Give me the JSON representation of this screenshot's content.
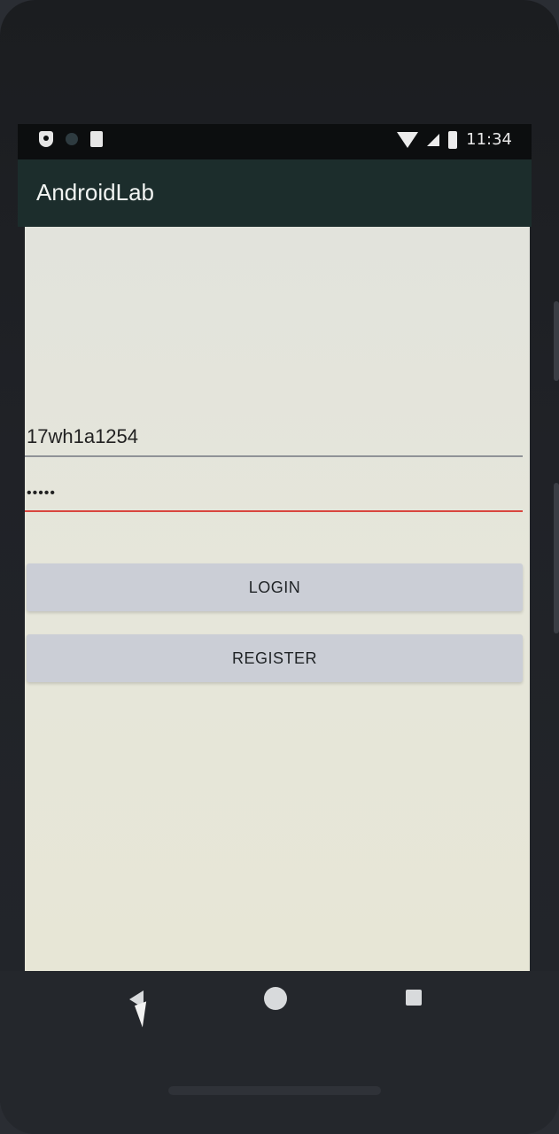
{
  "status_bar": {
    "time": "11:34",
    "left_icons": [
      "shield-icon",
      "dot-icon",
      "sd-card-icon"
    ],
    "right_icons": [
      "wifi-icon",
      "signal-icon",
      "battery-icon"
    ]
  },
  "app_bar": {
    "title": "AndroidLab"
  },
  "form": {
    "username_value": "17wh1a1254",
    "password_value": "•••••",
    "username_underline_color": "#8f9297",
    "password_underline_color": "#d9463f"
  },
  "buttons": {
    "login_label": "LOGIN",
    "register_label": "REGISTER"
  },
  "nav_bar": {
    "icons": [
      "back-icon",
      "home-icon",
      "recents-icon"
    ]
  },
  "colors": {
    "app_bar": "#1c2d2c",
    "button_bg": "#cbced6",
    "accent_error": "#d9463f"
  }
}
